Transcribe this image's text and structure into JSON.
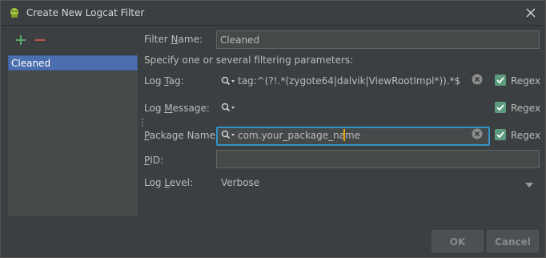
{
  "window": {
    "title": "Create New Logcat Filter"
  },
  "filters": {
    "items": [
      "Cleaned"
    ]
  },
  "form": {
    "filter_name": {
      "label_pre": "Filter ",
      "label_key": "N",
      "label_post": "ame:",
      "value": "Cleaned"
    },
    "hint": "Specify one or several filtering parameters:",
    "log_tag": {
      "label_pre": "Log ",
      "label_key": "T",
      "label_post": "ag:",
      "value": "tag:^(?!.*(zygote64|dalvik|ViewRootImpl*)).*$",
      "regex_label": "Regex"
    },
    "log_message": {
      "label_pre": "Log ",
      "label_key": "M",
      "label_post": "essage:",
      "value": "",
      "regex_label": "Regex"
    },
    "package_name": {
      "label_pre": "",
      "label_key": "P",
      "label_post": "ackage Name:",
      "value": "com.your_package_name",
      "regex_label": "Regex"
    },
    "pid": {
      "label_pre": "",
      "label_key": "P",
      "label_post": "ID:",
      "value": ""
    },
    "log_level": {
      "label_pre": "Log ",
      "label_key": "L",
      "label_post": "evel:",
      "value": "Verbose"
    }
  },
  "buttons": {
    "ok": "OK",
    "cancel": "Cancel"
  },
  "colors": {
    "background": "#3c3f41",
    "accent": "#3592c4",
    "checkbox": "#5d9b7e",
    "selection": "#4b6eaf"
  }
}
